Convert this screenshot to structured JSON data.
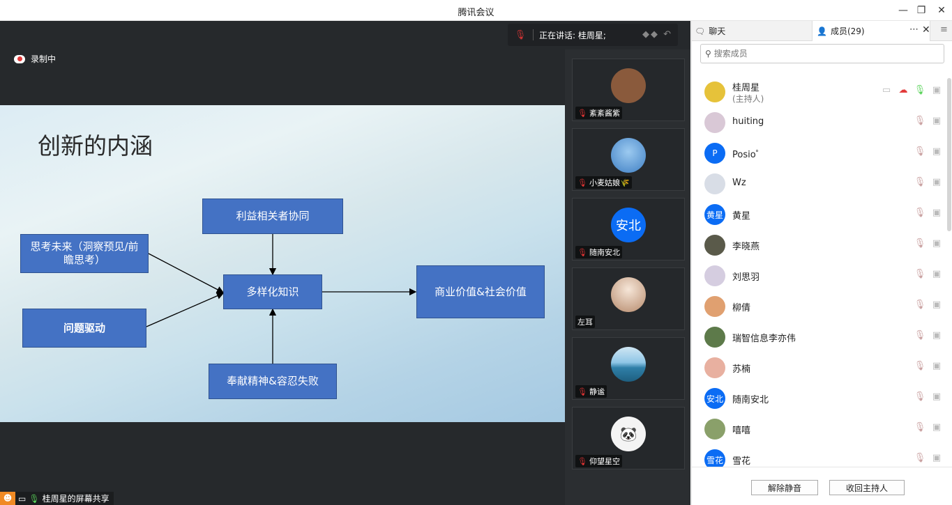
{
  "window": {
    "title": "腾讯会议"
  },
  "recording": {
    "label": "录制中"
  },
  "speaking": {
    "label": "正在讲话: 桂周星;"
  },
  "slide": {
    "title": "创新的内涵",
    "boxes": {
      "stakeholder": "利益相关者协同",
      "future": "思考未来（洞察预见/前瞻思考）",
      "problem": "问题驱动",
      "knowledge": "多样化知识",
      "value": "商业价值&社会价值",
      "devotion": "奉献精神&容忍失败"
    }
  },
  "thumbnails": [
    {
      "name": "紊紊酱紫",
      "avatar_color": "#8a5a3c",
      "muted": true
    },
    {
      "name": "小麦姑娘🌾",
      "avatar_color": "#3f7fc4",
      "muted": true
    },
    {
      "name": "随南安北",
      "avatar_text": "安北",
      "avatar_color": "#0b6cf4",
      "muted": true
    },
    {
      "name": "左耳",
      "avatar_color": "#e9d6c8",
      "muted": false
    },
    {
      "name": "静谧",
      "avatar_color": "#2f8fbf",
      "muted": true
    },
    {
      "name": "仰望星空",
      "avatar_color": "#f2f2f2",
      "muted": true
    }
  ],
  "sharebar": {
    "label": "桂周星的屏幕共享"
  },
  "panel": {
    "tab_chat": "聊天",
    "tab_members": "成员(29)",
    "search_placeholder": "搜索成员",
    "members": [
      {
        "name": "桂周星",
        "sub": "(主持人)",
        "avatar_color": "#e6c23a"
      },
      {
        "name": "huiting",
        "avatar_color": "#d9c8d6"
      },
      {
        "name": "Posio゜",
        "avatar_text": "P",
        "avatar_color": "#0b6cf4"
      },
      {
        "name": "Wz",
        "avatar_color": "#d8dde6"
      },
      {
        "name": "黄星",
        "avatar_text": "黄星",
        "avatar_color": "#0b6cf4"
      },
      {
        "name": "李晓燕",
        "avatar_color": "#5a5a4a"
      },
      {
        "name": "刘思羽",
        "avatar_color": "#d5cde0"
      },
      {
        "name": "柳倩",
        "avatar_color": "#e0a070"
      },
      {
        "name": "瑞智信息李亦伟",
        "avatar_color": "#5d7a4a"
      },
      {
        "name": "苏楠",
        "avatar_color": "#e8b0a0"
      },
      {
        "name": "随南安北",
        "avatar_text": "安北",
        "avatar_color": "#0b6cf4"
      },
      {
        "name": "嘻嘻",
        "avatar_color": "#8aa06a"
      },
      {
        "name": "雪花",
        "avatar_text": "雪花",
        "avatar_color": "#0b6cf4"
      }
    ],
    "btn_unmute": "解除静音",
    "btn_reclaim_host": "收回主持人"
  }
}
